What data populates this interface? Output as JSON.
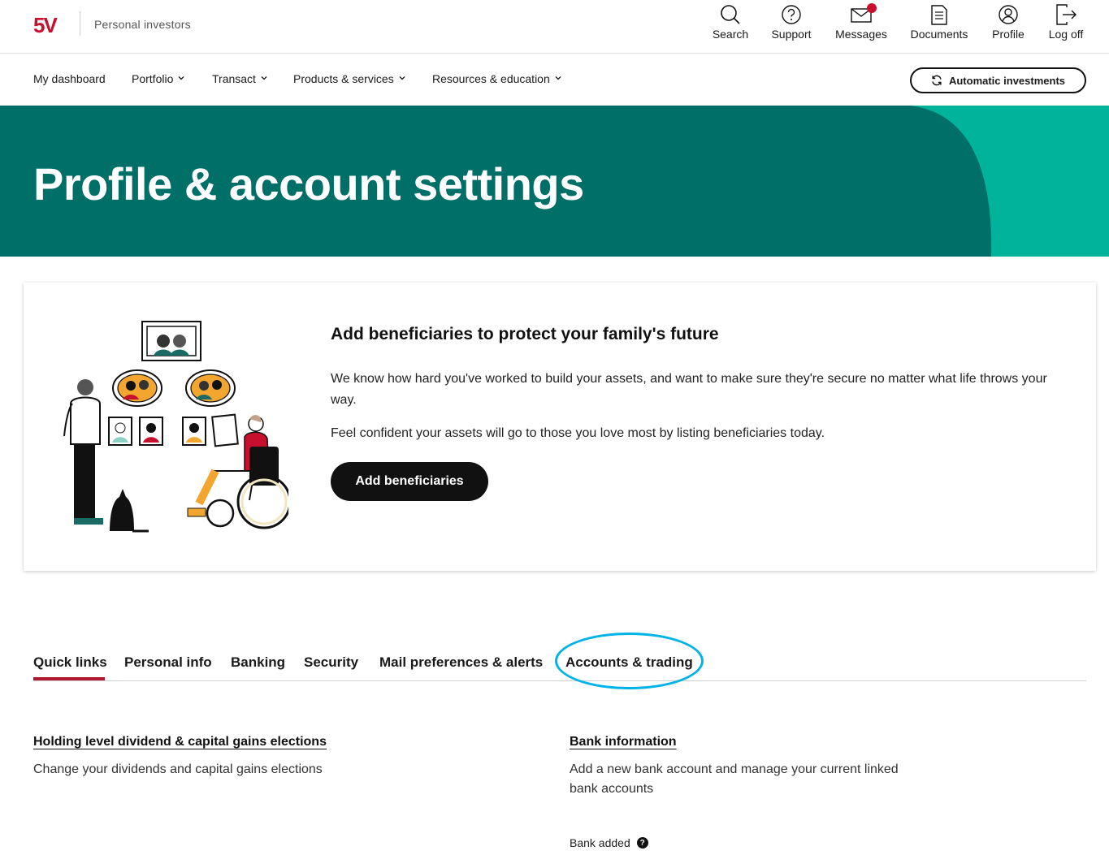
{
  "brand": {
    "logo_text": "5V",
    "site_label": "Personal investors",
    "brand_red": "#c8102e",
    "hero_teal": "#006f68",
    "hero_accent": "#00b39a",
    "tab_highlight": "#00b3e6"
  },
  "utility_nav": [
    {
      "label": "Search",
      "icon": "search-icon"
    },
    {
      "label": "Support",
      "icon": "help-circle-icon"
    },
    {
      "label": "Messages",
      "icon": "envelope-icon",
      "has_notification": true
    },
    {
      "label": "Documents",
      "icon": "document-icon"
    },
    {
      "label": "Profile",
      "icon": "user-icon"
    },
    {
      "label": "Log off",
      "icon": "logout-icon"
    }
  ],
  "main_nav": {
    "items": [
      {
        "label": "My dashboard",
        "dropdown": false
      },
      {
        "label": "Portfolio",
        "dropdown": true
      },
      {
        "label": "Transact",
        "dropdown": true
      },
      {
        "label": "Products & services",
        "dropdown": true
      },
      {
        "label": "Resources & education",
        "dropdown": true
      }
    ],
    "auto_invest_label": "Automatic investments",
    "auto_invest_icon": "refresh-icon"
  },
  "hero": {
    "title": "Profile & account settings"
  },
  "promo": {
    "title": "Add beneficiaries to protect your family's future",
    "paragraph_1": "We know how hard you've worked to build your assets, and want to make sure they're secure no matter what life throws your way.",
    "paragraph_2": "Feel confident your assets will go to those you love most by listing beneficiaries today.",
    "button_label": "Add beneficiaries"
  },
  "tabs": {
    "items": [
      {
        "label": "Quick links",
        "active": true
      },
      {
        "label": "Personal info",
        "active": false
      },
      {
        "label": "Banking",
        "active": false
      },
      {
        "label": "Security",
        "active": false
      },
      {
        "label": "Mail preferences & alerts",
        "active": false
      },
      {
        "label": "Accounts & trading",
        "active": false,
        "highlighted": true
      }
    ]
  },
  "quick_links": [
    {
      "title": "Holding level dividend & capital gains elections",
      "description": "Change your dividends and capital gains elections"
    },
    {
      "title": "Bank information",
      "description": "Add a new bank account and manage your current linked bank accounts",
      "status_label": "Bank added"
    }
  ]
}
